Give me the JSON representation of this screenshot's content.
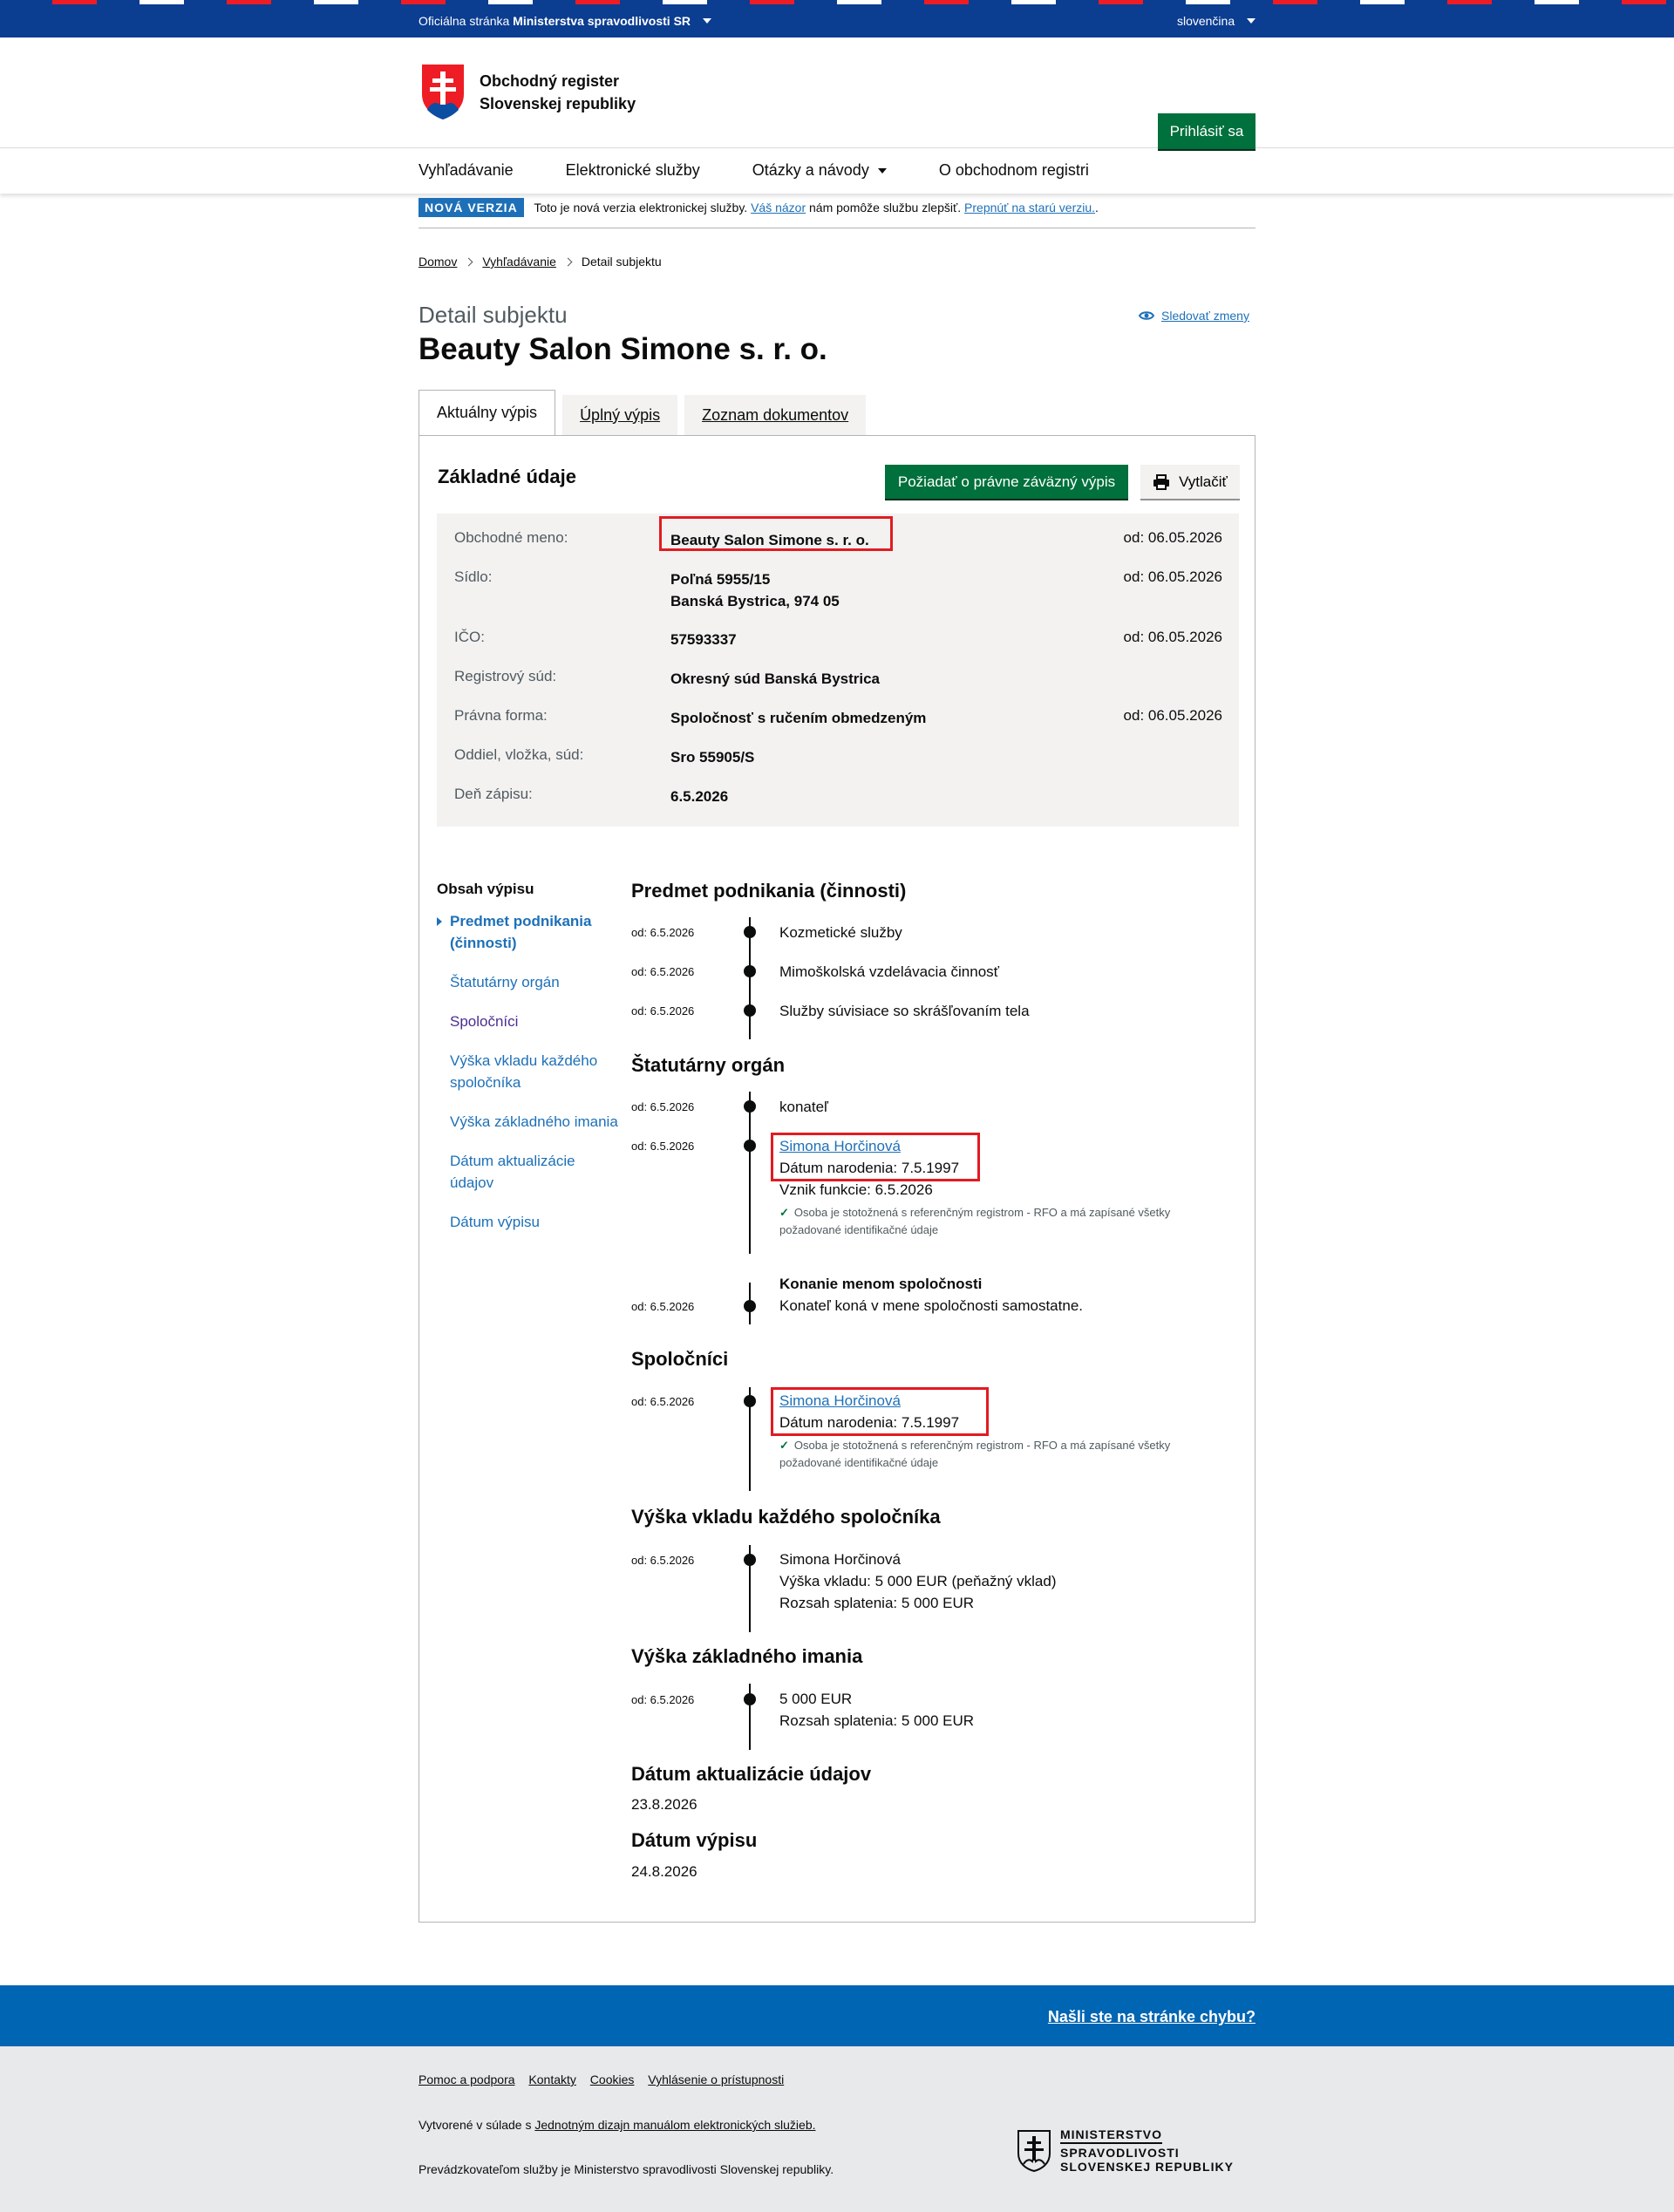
{
  "topbar": {
    "official_prefix": "Oficiálna stránka",
    "official_ministry": "Ministerstva spravodlivosti SR",
    "language": "slovenčina"
  },
  "header": {
    "logo_line1": "Obchodný register",
    "logo_line2": "Slovenskej republiky",
    "login_label": "Prihlásiť sa"
  },
  "nav": {
    "items": [
      "Vyhľadávanie",
      "Elektronické služby",
      "Otázky a návody",
      "O obchodnom registri"
    ]
  },
  "banner": {
    "tag": "NOVÁ VERZIA",
    "text1": "Toto je nová verzia elektronickej služby.",
    "link1": "Váš názor",
    "text2": "nám pomôže službu zlepšiť.",
    "link2": "Prepnúť na starú verziu.",
    "text3": "."
  },
  "breadcrumb": {
    "home": "Domov",
    "search": "Vyhľadávanie",
    "current": "Detail subjektu"
  },
  "page": {
    "caption": "Detail subjektu",
    "title": "Beauty Salon Simone s. r. o.",
    "follow_label": "Sledovať zmeny"
  },
  "tabs": [
    "Aktuálny výpis",
    "Úplný výpis",
    "Zoznam dokumentov"
  ],
  "basic": {
    "heading": "Základné údaje",
    "request_label": "Požiadať o právne záväzný výpis",
    "print_label": "Vytlačiť",
    "rows": [
      {
        "label": "Obchodné meno:",
        "value": "Beauty Salon Simone s. r. o.",
        "since": "od: 06.05.2026"
      },
      {
        "label": "Sídlo:",
        "value": "Poľná 5955/15",
        "value2": "Banská Bystrica, 974 05",
        "since": "od: 06.05.2026"
      },
      {
        "label": "IČO:",
        "value": "57593337",
        "since": "od: 06.05.2026"
      },
      {
        "label": "Registrový súd:",
        "value": "Okresný súd Banská Bystrica",
        "since": ""
      },
      {
        "label": "Právna forma:",
        "value": "Spoločnosť s ručením obmedzeným",
        "since": "od: 06.05.2026"
      },
      {
        "label": "Oddiel, vložka, súd:",
        "value": "Sro 55905/S",
        "since": ""
      },
      {
        "label": "Deň zápisu:",
        "value": "6.5.2026",
        "since": ""
      }
    ]
  },
  "toc": {
    "title": "Obsah výpisu",
    "items": [
      "Predmet podnikania (činnosti)",
      "Štatutárny orgán",
      "Spoločníci",
      "Výška vkladu každého spoločníka",
      "Výška základného imania",
      "Dátum aktualizácie údajov",
      "Dátum výpisu"
    ]
  },
  "sections": {
    "predmet": {
      "heading": "Predmet podnikania (činnosti)",
      "entries": [
        {
          "date": "od: 6.5.2026",
          "text": "Kozmetické služby"
        },
        {
          "date": "od: 6.5.2026",
          "text": "Mimoškolská vzdelávacia činnosť"
        },
        {
          "date": "od: 6.5.2026",
          "text": "Služby súvisiace so skrášľovaním tela"
        }
      ]
    },
    "statutar": {
      "heading": "Štatutárny orgán",
      "e1_date": "od: 6.5.2026",
      "e1_text": "konateľ",
      "e2_date": "od: 6.5.2026",
      "e2_name": "Simona Horčinová",
      "e2_birth": "Dátum narodenia: 7.5.1997",
      "e2_function": "Vznik funkcie: 6.5.2026",
      "e2_note": "Osoba je stotožnená s referenčným registrom - RFO a má zapísané všetky požadované identifikačné údaje",
      "e3_title": "Konanie menom spoločnosti",
      "e3_date": "od: 6.5.2026",
      "e3_text": "Konateľ koná v mene spoločnosti samostatne."
    },
    "spolocnici": {
      "heading": "Spoločníci",
      "date": "od: 6.5.2026",
      "name": "Simona Horčinová",
      "birth": "Dátum narodenia: 7.5.1997",
      "note": "Osoba je stotožnená s referenčným registrom - RFO a má zapísané všetky požadované identifikačné údaje"
    },
    "vklad": {
      "heading": "Výška vkladu každého spoločníka",
      "date": "od: 6.5.2026",
      "line1": "Simona Horčinová",
      "line2": "Výška vkladu: 5 000 EUR (peňažný vklad)",
      "line3": "Rozsah splatenia: 5 000 EUR"
    },
    "imanie": {
      "heading": "Výška základného imania",
      "date": "od: 6.5.2026",
      "line1": "5 000 EUR",
      "line2": "Rozsah splatenia: 5 000 EUR"
    },
    "aktualizacia": {
      "heading": "Dátum aktualizácie údajov",
      "value": "23.8.2026"
    },
    "vypis": {
      "heading": "Dátum výpisu",
      "value": "24.8.2026"
    }
  },
  "footer": {
    "error_link": "Našli ste na stránke chybu?",
    "links": [
      "Pomoc a podpora",
      "Kontakty",
      "Cookies",
      "Vyhlásenie o prístupnosti"
    ],
    "p1_prefix": "Vytvorené v súlade s",
    "p1_link": "Jednotným dizajn manuálom elektronických služieb.",
    "p2": "Prevádzkovateľom služby je Ministerstvo spravodlivosti Slovenskej republiky.",
    "ministry_l1": "MINISTERSTVO",
    "ministry_l2": "SPRAVODLIVOSTI",
    "ministry_l3": "SLOVENSKEJ REPUBLIKY"
  },
  "colors": {
    "topbar": "#0b3d91",
    "primary_button": "#00703c",
    "link": "#1d70b8",
    "highlight_box": "#e11b22",
    "footer_blue": "#0065b3"
  }
}
